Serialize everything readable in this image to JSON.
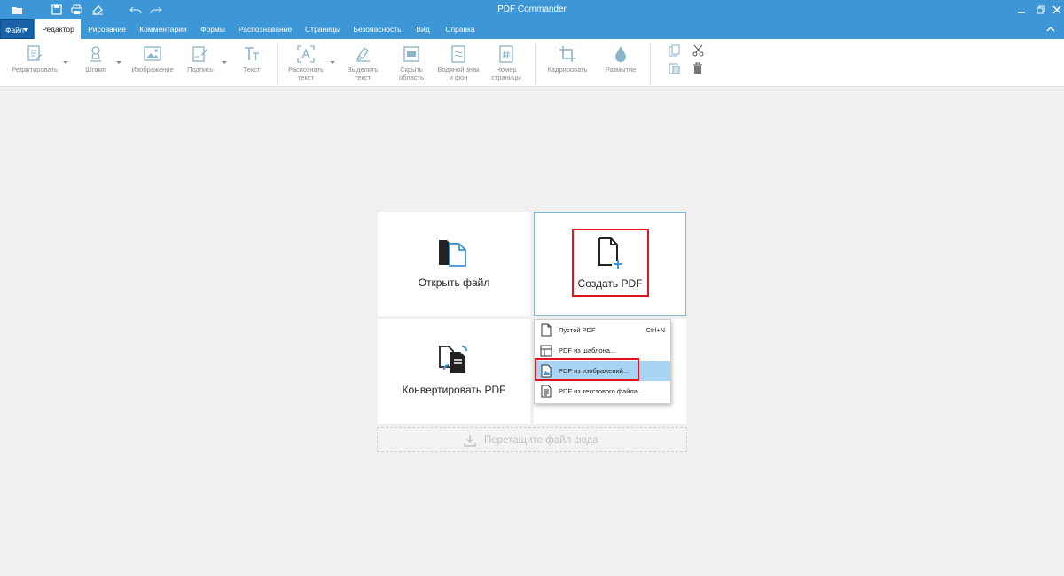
{
  "window": {
    "title": "PDF Commander"
  },
  "quick_access": [
    {
      "name": "open-folder-icon"
    },
    {
      "name": "save-icon"
    },
    {
      "name": "print-icon"
    },
    {
      "name": "eraser-icon"
    },
    {
      "name": "undo-icon"
    },
    {
      "name": "redo-icon"
    }
  ],
  "menubar": {
    "file_label": "Файл",
    "tabs": [
      {
        "label": "Редактор",
        "active": true
      },
      {
        "label": "Рисование"
      },
      {
        "label": "Комментарии"
      },
      {
        "label": "Формы"
      },
      {
        "label": "Распознавание"
      },
      {
        "label": "Страницы"
      },
      {
        "label": "Безопасность"
      },
      {
        "label": "Вид"
      },
      {
        "label": "Справка"
      }
    ]
  },
  "toolbar": {
    "edit": "Редактировать",
    "stamp": "Штамп",
    "image": "Изображение",
    "signature": "Подпись",
    "text": "Текст",
    "recognize_text": "Распознать\nтекст",
    "select_text": "Выделить\nтекст",
    "hide_area": "Скрыть\nобласть",
    "watermark": "Водяной знак\nи фон",
    "page_number": "Номер\nстраницы",
    "crop": "Кадрировать",
    "blur": "Размытие"
  },
  "start": {
    "open_file": "Открыть файл",
    "create_pdf": "Создать PDF",
    "convert_pdf": "Конвертировать PDF"
  },
  "create_menu": [
    {
      "label": "Пустой PDF",
      "shortcut": "Ctrl+N",
      "icon": "blank-page-icon"
    },
    {
      "label": "PDF из шаблона...",
      "shortcut": "",
      "icon": "template-icon"
    },
    {
      "label": "PDF из изображений...",
      "shortcut": "",
      "icon": "image-file-icon",
      "highlighted": true
    },
    {
      "label": "PDF из текстового файла...",
      "shortcut": "",
      "icon": "text-file-icon"
    }
  ],
  "dropzone": {
    "label": "Перетащите файл сюда"
  },
  "colors": {
    "accent": "#3d96d6",
    "file_button": "#1a62a7",
    "highlight": "#a9d4f3",
    "annotation_red": "#e0141e"
  }
}
